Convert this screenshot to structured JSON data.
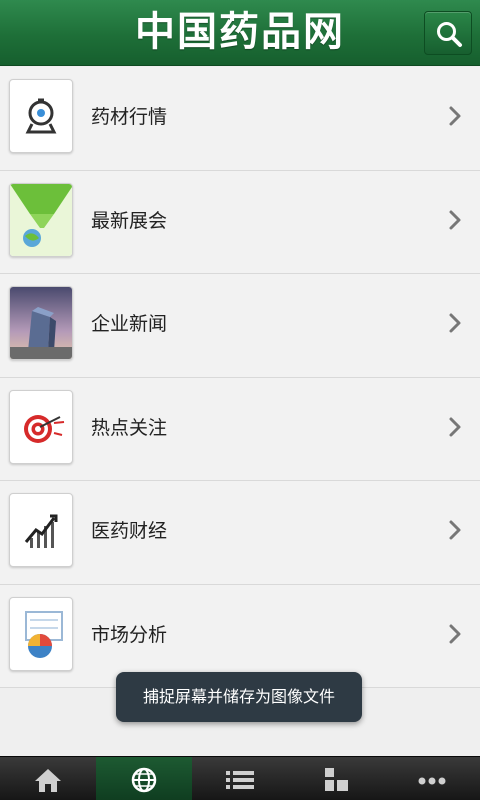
{
  "header": {
    "title": "中国药品网",
    "search_icon": "search-icon"
  },
  "menu": {
    "items": [
      {
        "label": "药材行情",
        "icon": "pharmacy-icon"
      },
      {
        "label": "最新展会",
        "icon": "exhibition-icon"
      },
      {
        "label": "企业新闻",
        "icon": "building-icon"
      },
      {
        "label": "热点关注",
        "icon": "target-icon"
      },
      {
        "label": "医药财经",
        "icon": "finance-chart-icon"
      },
      {
        "label": "市场分析",
        "icon": "pie-chart-icon"
      }
    ]
  },
  "toast": {
    "text": "捕捉屏幕并储存为图像文件"
  },
  "tabbar": {
    "tabs": [
      {
        "icon": "home-icon",
        "active": false
      },
      {
        "icon": "globe-icon",
        "active": true
      },
      {
        "icon": "list-icon",
        "active": false
      },
      {
        "icon": "blocks-icon",
        "active": false
      },
      {
        "icon": "more-icon",
        "active": false
      }
    ]
  },
  "colors": {
    "header_green": "#1e6f38",
    "active_tab_green": "#1d5a32",
    "list_background": "#f2f2f2",
    "toast_background": "#2e3a44"
  }
}
